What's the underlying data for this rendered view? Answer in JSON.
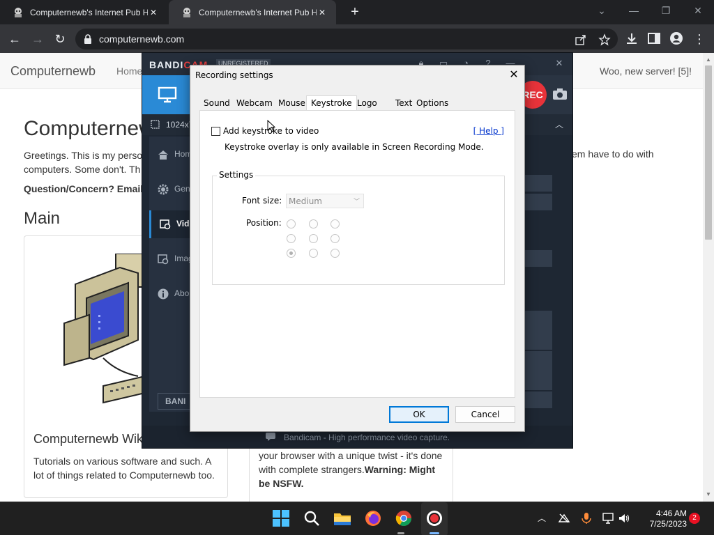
{
  "browser": {
    "tabs": [
      {
        "title": "Computernewb's Internet Pub H",
        "active": false
      },
      {
        "title": "Computernewb's Internet Pub H",
        "active": true
      }
    ],
    "url": "computernewb.com"
  },
  "webpage": {
    "brand": "Computernewb",
    "nav_home": "Home",
    "nav_right": "Woo, new server! [5]!",
    "heading": "Computernewb",
    "greeting_line1": "Greetings. This is my perso",
    "greeting_line2": "computers. Some don't. Th",
    "greeting_right": "em have to do with",
    "question": "Question/Concern? Email",
    "main_heading": "Main",
    "card1_title": "Computernewb Wiki",
    "card1_text": "Tutorials on various software and such. A lot of things related to Computernewb too.",
    "card2_text_plain": "your browser with a unique twist - it's done with complete strangers.",
    "card2_text_bold": "Warning: Might be NSFW."
  },
  "bandicam": {
    "logo_main": "BANDI",
    "logo_cam": "CAM",
    "unregistered": "UNREGISTERED",
    "rec_label": "REC",
    "size_text": "1024x7",
    "sidebar": [
      {
        "label": "Home",
        "icon": "home-icon"
      },
      {
        "label": "General",
        "icon": "gear-icon"
      },
      {
        "label": "Video",
        "icon": "video-settings-icon",
        "active": true
      },
      {
        "label": "Image",
        "icon": "image-settings-icon"
      },
      {
        "label": "About",
        "icon": "info-icon"
      }
    ],
    "bandi_button": "BANI",
    "status_text": "Bandicam - High performance video capture."
  },
  "dialog": {
    "title": "Recording settings",
    "tabs": [
      "Sound",
      "Webcam",
      "Mouse",
      "Keystroke",
      "Logo",
      "Text",
      "Options"
    ],
    "active_tab": "Keystroke",
    "checkbox_label": "Add keystroke to video",
    "checkbox_checked": false,
    "help_link": "[ Help ]",
    "overlay_note": "Keystroke overlay is only available in Screen Recording Mode.",
    "settings_group": "Settings",
    "font_size_label": "Font size:",
    "font_size_value": "Medium",
    "position_label": "Position:",
    "selected_position": "bottom-left",
    "ok": "OK",
    "cancel": "Cancel"
  },
  "taskbar": {
    "time": "4:46 AM",
    "date": "7/25/2023",
    "notifications": "2"
  }
}
